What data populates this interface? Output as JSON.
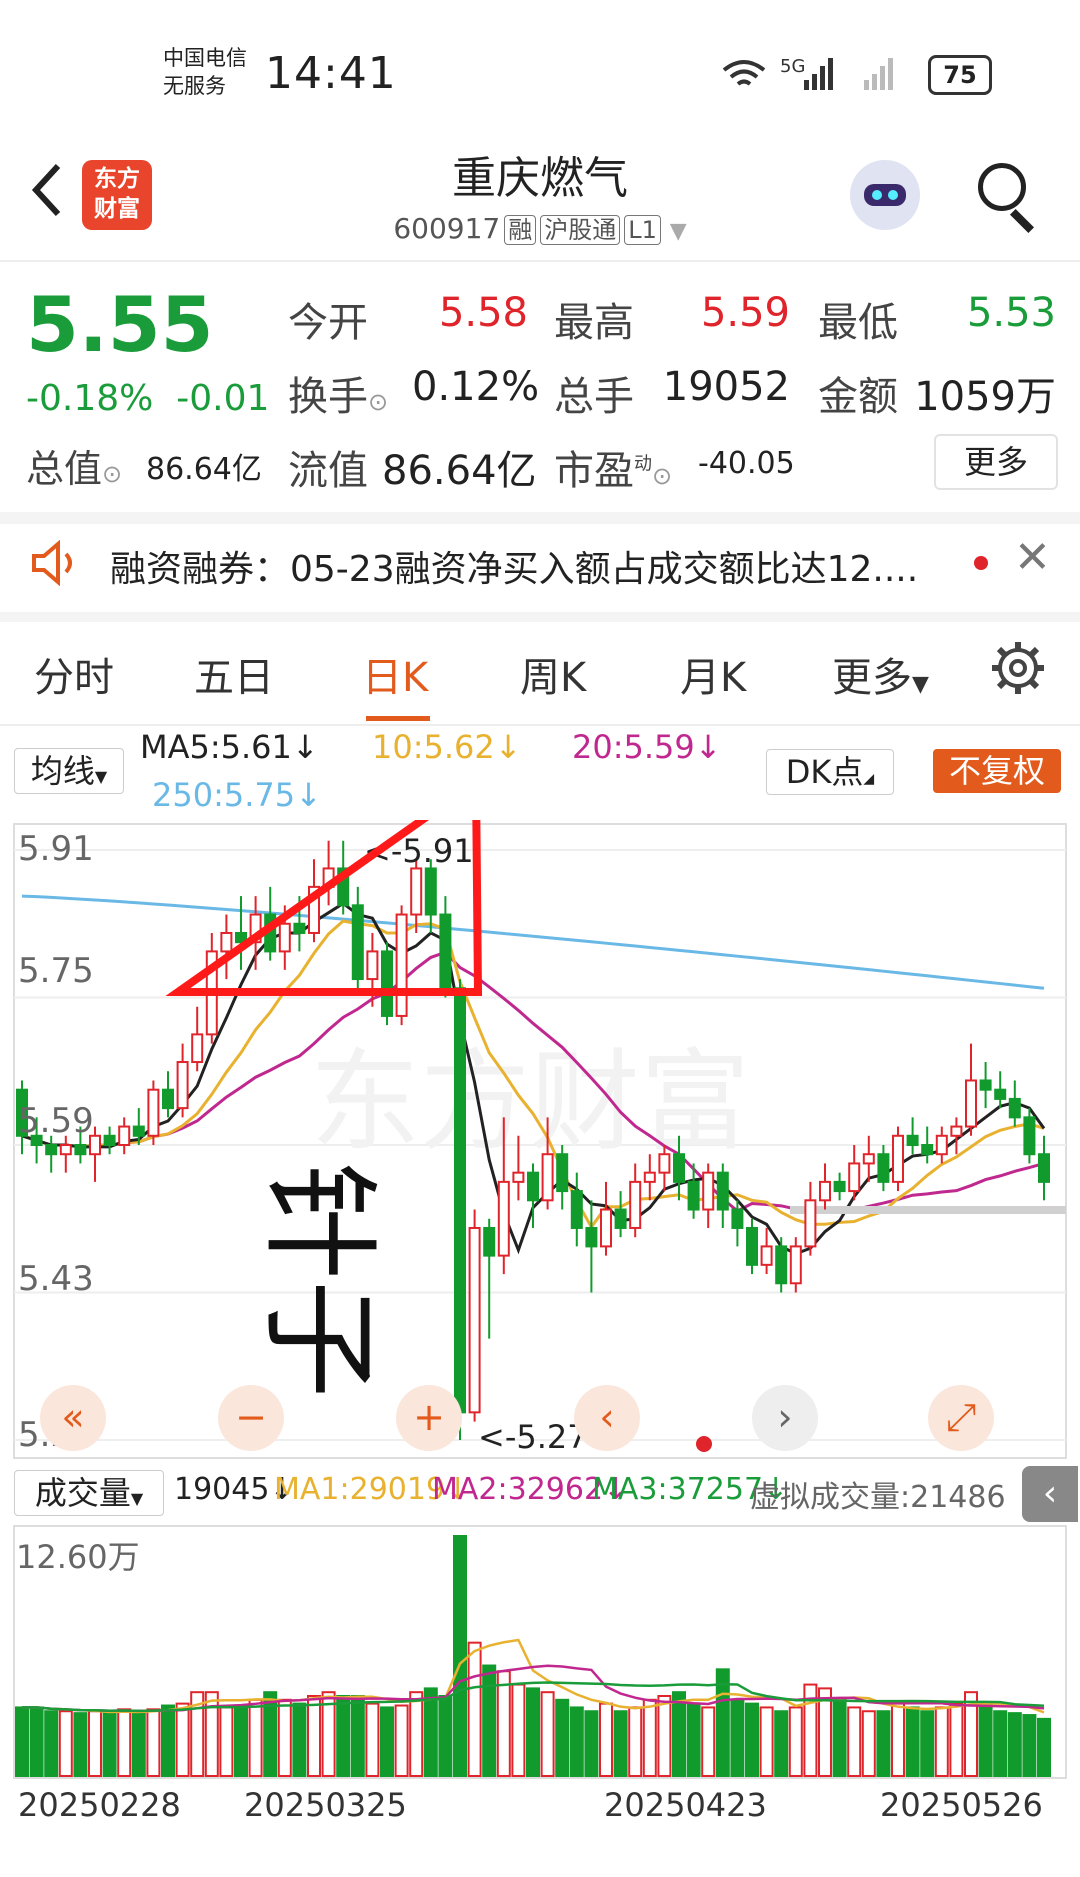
{
  "status_bar": {
    "carrier_line1": "中国电信",
    "carrier_line2": "无服务",
    "time": "14:41",
    "network": "5G",
    "battery": "75"
  },
  "header": {
    "back_icon": "chevron-left-icon",
    "logo_line1": "东方",
    "logo_line2": "财富",
    "title": "重庆燃气",
    "code": "600917",
    "tags": [
      "融",
      "沪股通",
      "L1"
    ]
  },
  "quote": {
    "price": "5.55",
    "change_pct": "-0.18%",
    "change": "-0.01",
    "open_label": "今开",
    "open": "5.58",
    "high_label": "最高",
    "high": "5.59",
    "low_label": "最低",
    "low": "5.53",
    "turnover_label": "换手",
    "turnover": "0.12%",
    "volume_label": "总手",
    "volume": "19052",
    "amount_label": "金额",
    "amount": "1059万",
    "mktcap_label": "总值",
    "mktcap": "86.64亿",
    "float_label": "流值",
    "float": "86.64亿",
    "pe_label": "市盈",
    "pe_sup": "动",
    "pe": "-40.05",
    "more_button": "更多"
  },
  "notice": {
    "text": "融资融券：05-23融资净买入额占成交额比达12...."
  },
  "tabs": [
    "分时",
    "五日",
    "日K",
    "周K",
    "月K",
    "更多"
  ],
  "active_tab": "日K",
  "ma_legend": {
    "selector": "均线",
    "ma5": "MA5:5.61↓",
    "ma10": "10:5.62↓",
    "ma20": "20:5.59↓",
    "ma250": "250:5.75↓",
    "dk_button": "DK点",
    "fq_button": "不复权",
    "colors": {
      "ma5": "#222222",
      "ma10": "#e8b230",
      "ma20": "#c0288f",
      "ma250": "#6ab8e6"
    }
  },
  "kline": {
    "price_labels": [
      "5.91",
      "5.75",
      "5.59",
      "5.43",
      "5.27"
    ],
    "high_marker": "<-5.91",
    "low_marker": "<-5.27",
    "watermark": "东方财富",
    "annotation": "针子"
  },
  "volume_legend": {
    "selector": "成交量",
    "vol": "19045↓",
    "ma1": "MA1:29019↓",
    "ma2": "MA2:32962↓",
    "ma3": "MA3:37257↓",
    "virtual": "虚拟成交量:21486",
    "max_label": "12.60万"
  },
  "dates": [
    "20250228",
    "20250325",
    "20250423",
    "20250526"
  ],
  "chart_data": {
    "type": "candlestick",
    "y_ticks": [
      5.91,
      5.75,
      5.59,
      5.43,
      5.27
    ],
    "ylim": [
      5.27,
      5.91
    ],
    "x_ticks": [
      "20250228",
      "20250325",
      "20250423",
      "20250526"
    ],
    "candles": [
      [
        5.65,
        5.6,
        5.66,
        5.58
      ],
      [
        5.6,
        5.59,
        5.62,
        5.57
      ],
      [
        5.59,
        5.58,
        5.6,
        5.56
      ],
      [
        5.58,
        5.59,
        5.6,
        5.56
      ],
      [
        5.59,
        5.58,
        5.61,
        5.57
      ],
      [
        5.58,
        5.6,
        5.61,
        5.55
      ],
      [
        5.6,
        5.59,
        5.61,
        5.58
      ],
      [
        5.59,
        5.61,
        5.62,
        5.58
      ],
      [
        5.61,
        5.6,
        5.63,
        5.59
      ],
      [
        5.6,
        5.65,
        5.66,
        5.59
      ],
      [
        5.65,
        5.63,
        5.67,
        5.62
      ],
      [
        5.63,
        5.68,
        5.7,
        5.62
      ],
      [
        5.68,
        5.71,
        5.74,
        5.67
      ],
      [
        5.71,
        5.8,
        5.82,
        5.7
      ],
      [
        5.8,
        5.82,
        5.84,
        5.77
      ],
      [
        5.82,
        5.81,
        5.86,
        5.78
      ],
      [
        5.81,
        5.84,
        5.86,
        5.78
      ],
      [
        5.84,
        5.8,
        5.87,
        5.79
      ],
      [
        5.8,
        5.83,
        5.85,
        5.78
      ],
      [
        5.83,
        5.82,
        5.86,
        5.8
      ],
      [
        5.82,
        5.87,
        5.9,
        5.81
      ],
      [
        5.87,
        5.89,
        5.92,
        5.85
      ],
      [
        5.89,
        5.85,
        5.92,
        5.84
      ],
      [
        5.85,
        5.77,
        5.87,
        5.76
      ],
      [
        5.77,
        5.8,
        5.82,
        5.74
      ],
      [
        5.8,
        5.73,
        5.81,
        5.72
      ],
      [
        5.73,
        5.84,
        5.85,
        5.72
      ],
      [
        5.84,
        5.89,
        5.9,
        5.82
      ],
      [
        5.89,
        5.84,
        5.9,
        5.82
      ],
      [
        5.84,
        5.76,
        5.86,
        5.75
      ],
      [
        5.76,
        5.3,
        5.77,
        5.27
      ],
      [
        5.3,
        5.5,
        5.52,
        5.29
      ],
      [
        5.5,
        5.47,
        5.51,
        5.38
      ],
      [
        5.47,
        5.55,
        5.62,
        5.45
      ],
      [
        5.55,
        5.56,
        5.6,
        5.53
      ],
      [
        5.56,
        5.53,
        5.57,
        5.5
      ],
      [
        5.53,
        5.58,
        5.62,
        5.52
      ],
      [
        5.58,
        5.54,
        5.59,
        5.52
      ],
      [
        5.54,
        5.5,
        5.56,
        5.48
      ],
      [
        5.5,
        5.48,
        5.53,
        5.43
      ],
      [
        5.48,
        5.52,
        5.55,
        5.47
      ],
      [
        5.52,
        5.5,
        5.54,
        5.49
      ],
      [
        5.5,
        5.55,
        5.57,
        5.49
      ],
      [
        5.55,
        5.56,
        5.58,
        5.53
      ],
      [
        5.56,
        5.58,
        5.59,
        5.54
      ],
      [
        5.58,
        5.55,
        5.6,
        5.53
      ],
      [
        5.55,
        5.52,
        5.57,
        5.51
      ],
      [
        5.52,
        5.56,
        5.57,
        5.5
      ],
      [
        5.56,
        5.52,
        5.57,
        5.5
      ],
      [
        5.52,
        5.5,
        5.53,
        5.48
      ],
      [
        5.5,
        5.46,
        5.51,
        5.45
      ],
      [
        5.46,
        5.48,
        5.5,
        5.45
      ],
      [
        5.48,
        5.44,
        5.49,
        5.43
      ],
      [
        5.44,
        5.48,
        5.49,
        5.43
      ],
      [
        5.48,
        5.53,
        5.55,
        5.47
      ],
      [
        5.53,
        5.55,
        5.57,
        5.52
      ],
      [
        5.55,
        5.54,
        5.56,
        5.53
      ],
      [
        5.54,
        5.57,
        5.59,
        5.53
      ],
      [
        5.57,
        5.58,
        5.6,
        5.55
      ],
      [
        5.58,
        5.55,
        5.59,
        5.54
      ],
      [
        5.55,
        5.6,
        5.61,
        5.54
      ],
      [
        5.6,
        5.59,
        5.62,
        5.58
      ],
      [
        5.59,
        5.58,
        5.61,
        5.57
      ],
      [
        5.58,
        5.6,
        5.61,
        5.57
      ],
      [
        5.6,
        5.61,
        5.62,
        5.58
      ],
      [
        5.61,
        5.66,
        5.7,
        5.6
      ],
      [
        5.66,
        5.65,
        5.68,
        5.63
      ],
      [
        5.65,
        5.64,
        5.67,
        5.63
      ],
      [
        5.64,
        5.62,
        5.66,
        5.61
      ],
      [
        5.62,
        5.58,
        5.63,
        5.57
      ],
      [
        5.58,
        5.55,
        5.6,
        5.53
      ]
    ],
    "volume": [
      36,
      36,
      34,
      34,
      33,
      34,
      33,
      35,
      33,
      35,
      37,
      38,
      44,
      44,
      36,
      37,
      40,
      44,
      40,
      38,
      42,
      44,
      42,
      42,
      38,
      36,
      37,
      44,
      46,
      42,
      126,
      70,
      58,
      55,
      48,
      46,
      44,
      40,
      36,
      34,
      38,
      34,
      36,
      40,
      42,
      44,
      38,
      36,
      56,
      40,
      38,
      36,
      34,
      36,
      48,
      46,
      40,
      36,
      34,
      34,
      38,
      36,
      34,
      36,
      38,
      44,
      38,
      34,
      33,
      32,
      30
    ]
  }
}
